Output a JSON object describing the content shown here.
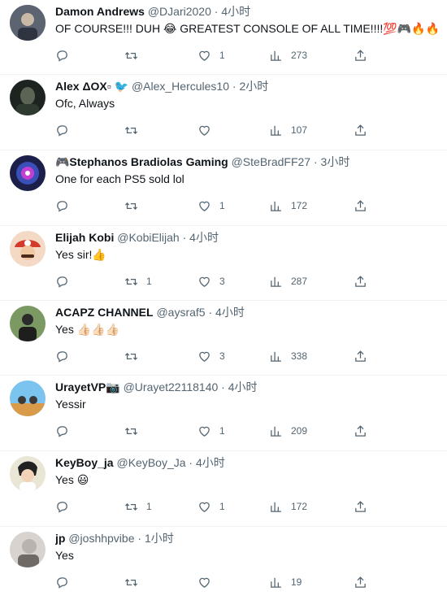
{
  "tweets": [
    {
      "name": "Damon Andrews",
      "handle": "@DJari2020",
      "sep": "·",
      "time": "4小时",
      "text": "OF COURSE!!! DUH 😂 GREATEST CONSOLE OF ALL TIME!!!!💯🎮🔥🔥",
      "replies": "",
      "retweets": "",
      "likes": "1",
      "views": "273",
      "avatar_color": "#5b6470"
    },
    {
      "name": "Alex ΔOX▫ 🐦",
      "handle": "@Alex_Hercules10",
      "sep": "·",
      "time": "2小时",
      "text": "Ofc, Always",
      "replies": "",
      "retweets": "",
      "likes": "",
      "views": "107",
      "avatar_color": "#2e3a2f"
    },
    {
      "name": "🎮Stephanos Bradiolas Gaming",
      "handle": "@SteBradFF27",
      "sep": "·",
      "time": "3小时",
      "text": "One for each PS5 sold lol",
      "replies": "",
      "retweets": "",
      "likes": "1",
      "views": "172",
      "avatar_color": "#3a4fb8"
    },
    {
      "name": "Elijah Kobi",
      "handle": "@KobiElijah",
      "sep": "·",
      "time": "4小时",
      "text": "Yes sir!👍",
      "replies": "",
      "retweets": "1",
      "likes": "3",
      "views": "287",
      "avatar_color": "#d33a2c"
    },
    {
      "name": "ACAPZ CHANNEL",
      "handle": "@aysraf5",
      "sep": "·",
      "time": "4小时",
      "text": "Yes 👍🏻👍🏻👍🏻",
      "replies": "",
      "retweets": "",
      "likes": "3",
      "views": "338",
      "avatar_color": "#4a6b3a"
    },
    {
      "name": "UrayetVP📷",
      "handle": "@Urayet22118140",
      "sep": "·",
      "time": "4小时",
      "text": "Yessir",
      "replies": "",
      "retweets": "",
      "likes": "1",
      "views": "209",
      "avatar_color": "#3f8fd6"
    },
    {
      "name": "KeyBoy_ja",
      "handle": "@KeyBoy_Ja",
      "sep": "·",
      "time": "4小时",
      "text": "Yes 😃",
      "replies": "",
      "retweets": "1",
      "likes": "1",
      "views": "172",
      "avatar_color": "#c9c9b8"
    },
    {
      "name": "jp",
      "handle": "@joshhpvibe",
      "sep": "·",
      "time": "1小时",
      "text": "Yes",
      "replies": "",
      "retweets": "",
      "likes": "",
      "views": "19",
      "avatar_color": "#b9b2ad"
    }
  ],
  "icons": {
    "reply": "reply-icon",
    "retweet": "retweet-icon",
    "like": "like-icon",
    "views": "views-icon",
    "share": "share-icon"
  },
  "colors": {
    "text": "#0f1419",
    "muted": "#536471",
    "divider": "#eff3f4"
  }
}
